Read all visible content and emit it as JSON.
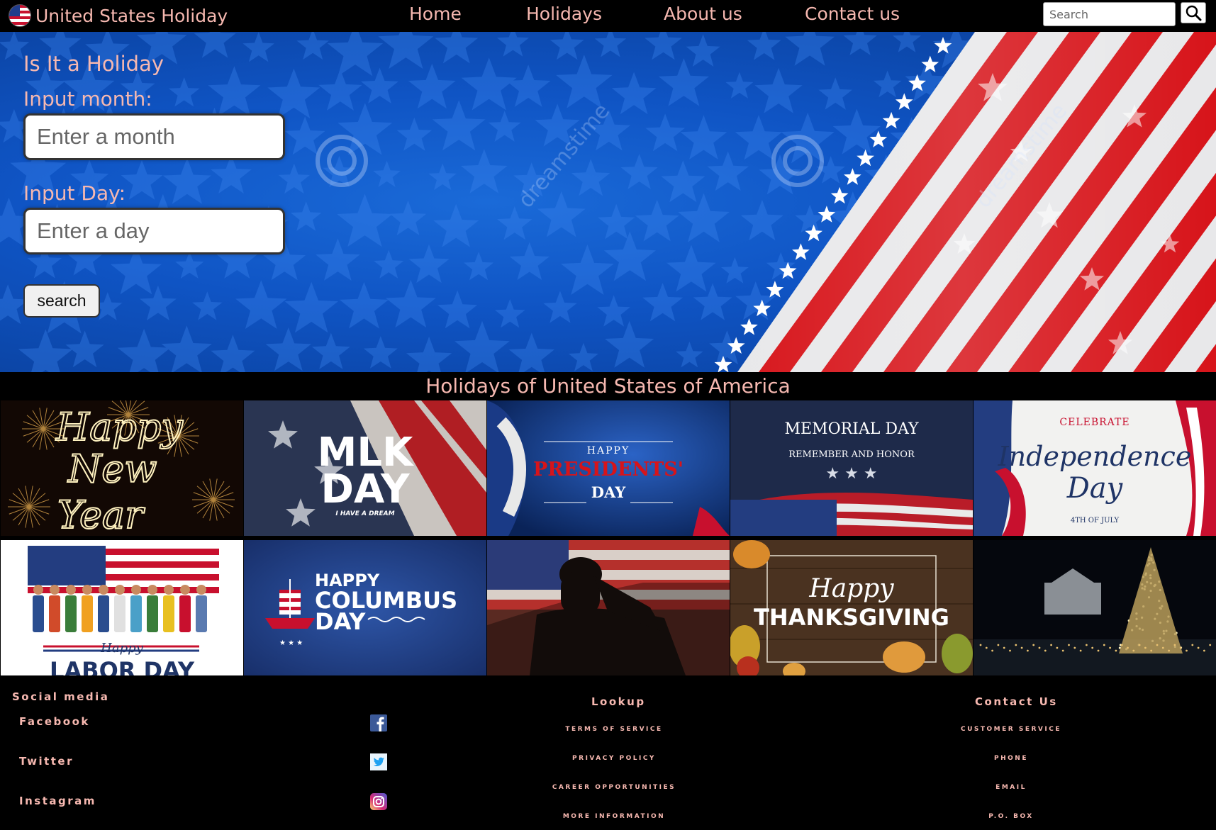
{
  "nav": {
    "brand": "United States Holiday",
    "links": [
      "Home",
      "Holidays",
      "About us",
      "Contact us"
    ],
    "search_placeholder": "Search"
  },
  "hero": {
    "title": "Is It a Holiday",
    "month_label": "Input month:",
    "month_placeholder": "Enter a month",
    "day_label": "Input Day:",
    "day_placeholder": "Enter a day",
    "search_button": "search"
  },
  "gallery": {
    "title": "Holidays of United States of America",
    "tiles": [
      {
        "name": "new-year",
        "lines": [
          "Happy",
          "New",
          "Year"
        ]
      },
      {
        "name": "mlk-day",
        "lines": [
          "MLK",
          "DAY",
          "I HAVE A DREAM"
        ]
      },
      {
        "name": "presidents-day",
        "lines": [
          "HAPPY",
          "PRESIDENTS'",
          "DAY"
        ]
      },
      {
        "name": "memorial-day",
        "lines": [
          "MEMORIAL DAY",
          "REMEMBER AND HONOR"
        ]
      },
      {
        "name": "independence-day",
        "lines": [
          "CELEBRATE",
          "Independence",
          "Day",
          "4TH OF JULY"
        ]
      },
      {
        "name": "labor-day",
        "lines": [
          "Happy",
          "LABOR DAY"
        ]
      },
      {
        "name": "columbus-day",
        "lines": [
          "HAPPY",
          "COLUMBUS",
          "DAY"
        ]
      },
      {
        "name": "veterans-day",
        "lines": []
      },
      {
        "name": "thanksgiving",
        "lines": [
          "Happy",
          "THANKSGIVING"
        ]
      },
      {
        "name": "christmas",
        "lines": []
      }
    ]
  },
  "footer": {
    "social_title": "Social media",
    "social": [
      "Facebook",
      "Twitter",
      "Instagram"
    ],
    "lookup_title": "Lookup",
    "lookup": [
      "TERMS OF SERVICE",
      "PRIVACY POLICY",
      "CAREER OPPORTUNITIES",
      "MORE INFORMATION"
    ],
    "contact_title": "Contact Us",
    "contact": [
      "CUSTOMER SERVICE",
      "PHONE",
      "EMAIL",
      "P.O. BOX"
    ]
  },
  "watermark": "dreamstime",
  "colors": {
    "accent_text": "#f6b8b0",
    "hero_blue": "#0f54c4",
    "flag_red": "#d7141a",
    "navy": "#1f3d8c"
  }
}
